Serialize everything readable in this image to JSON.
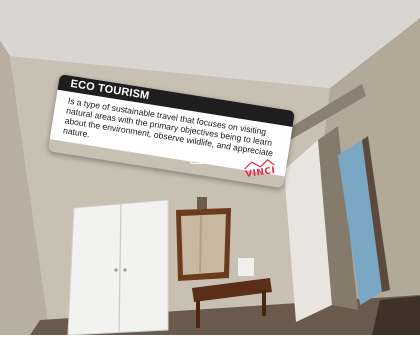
{
  "overlay": {
    "title": "ECO TOURISM",
    "body": "Is a type of sustainable travel that focuses on visiting natural areas with the primary objectives being to learn about the environment, observe wildlife, and appreciate nature."
  },
  "controls": {
    "play_icon": "play-icon",
    "info_icon": "info-icon"
  },
  "logo": {
    "text": "VINCI",
    "color": "#e32b45"
  }
}
